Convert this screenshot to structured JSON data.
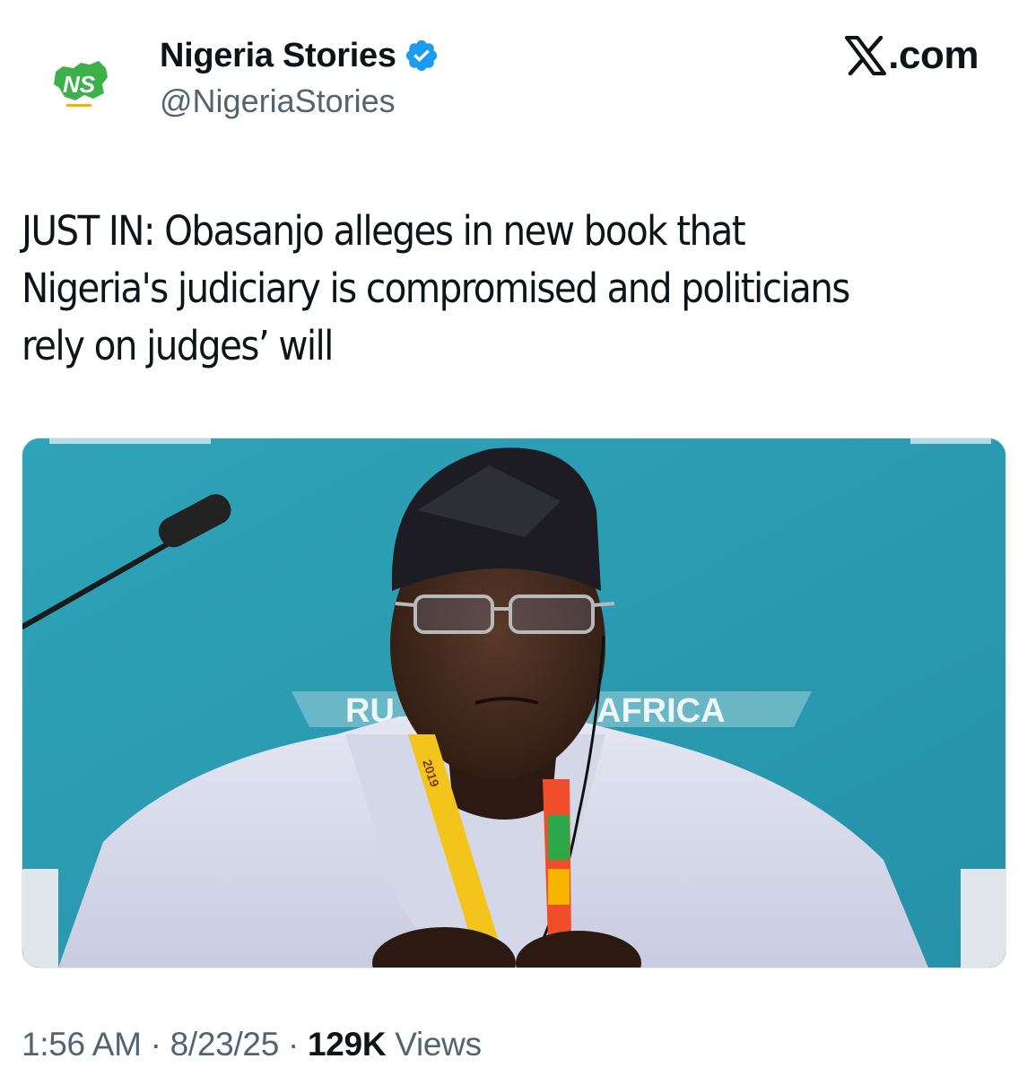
{
  "account": {
    "display_name": "Nigeria Stories",
    "handle": "@NigeriaStories",
    "verified": true,
    "avatar_text": "NS"
  },
  "brand": {
    "logo_name": "x-logo-icon",
    "domain": ".com"
  },
  "tweet": {
    "text": "JUST IN: Obasanjo alleges in new book that\nNigeria's judiciary is compromised and politicians\nrely on judges’ will"
  },
  "media": {
    "backdrop_text_left": "RU",
    "backdrop_text_right": "AFRICA",
    "lanyard_text": "2019"
  },
  "meta": {
    "time": "1:56 AM",
    "separator": " · ",
    "date": "8/23/25",
    "views_count": "129K",
    "views_label": "Views"
  },
  "colors": {
    "verified_blue": "#1d9bf0",
    "secondary_text": "#536471",
    "primary_text": "#0f1419",
    "backdrop_teal": "#2a9cb2",
    "logo_green": "#3cb14a"
  }
}
